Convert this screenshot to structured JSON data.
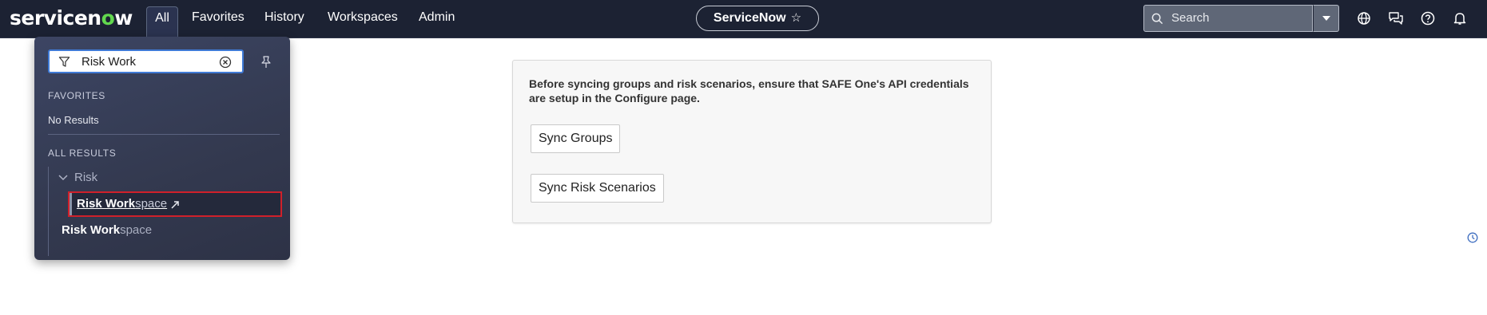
{
  "header": {
    "logo_pre": "servicen",
    "logo_o": "o",
    "logo_post": "w",
    "nav": [
      "All",
      "Favorites",
      "History",
      "Workspaces",
      "Admin"
    ],
    "instance_name": "ServiceNow",
    "search_placeholder": "Search",
    "icons": [
      "globe-icon",
      "chat-icon",
      "help-icon",
      "bell-icon"
    ]
  },
  "menu": {
    "filter_value": "Risk Work",
    "favorites_heading": "FAVORITES",
    "no_results": "No Results",
    "all_results_heading": "ALL RESULTS",
    "group_label": "Risk",
    "selected_match": "Risk Work",
    "selected_rest": "space",
    "second_match": "Risk Work",
    "second_rest": "space"
  },
  "content": {
    "message": "Before syncing groups and risk scenarios, ensure that SAFE One's API credentials are setup in the Configure page.",
    "sync_groups_label": "Sync Groups",
    "sync_scenarios_label": "Sync Risk Scenarios"
  },
  "colors": {
    "topbar": "#1c2233",
    "accent_green": "#62d84e",
    "selection_border": "#d0202a"
  }
}
